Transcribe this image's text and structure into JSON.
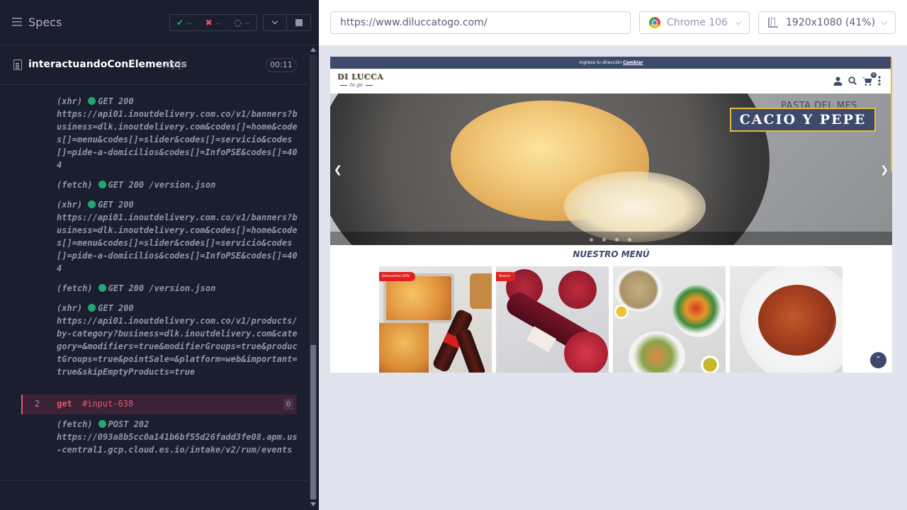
{
  "runner": {
    "header": {
      "title": "Specs",
      "stats": {
        "passed": "--",
        "failed": "--",
        "pending": "--"
      }
    },
    "file": {
      "name": "interactuandoConElementos",
      "ext": ".cy.js",
      "time": "00:11"
    },
    "logs": [
      {
        "type": "(xhr)",
        "status": "GET 200",
        "url": "https://api01.inoutdelivery.com.co/v1/banners?business=dlk.inoutdelivery.com&codes[]=home&codes[]=menu&codes[]=slider&codes[]=servicio&codes[]=pide-a-domicilios&codes[]=InfoPSE&codes[]=404"
      },
      {
        "type": "(fetch)",
        "status": "GET 200 /version.json",
        "url": ""
      },
      {
        "type": "(xhr)",
        "status": "GET 200",
        "url": "https://api01.inoutdelivery.com.co/v1/banners?business=dlk.inoutdelivery.com&codes[]=home&codes[]=menu&codes[]=slider&codes[]=servicio&codes[]=pide-a-domicilios&codes[]=InfoPSE&codes[]=404"
      },
      {
        "type": "(fetch)",
        "status": "GET 200 /version.json",
        "url": ""
      },
      {
        "type": "(xhr)",
        "status": "GET 200",
        "url": "https://api01.inoutdelivery.com.co/v1/products/by-category?business=dlk.inoutdelivery.com&category=&modifiers=true&modifierGroups=true&productGroups=true&pointSale=&platform=web&important=true&skipEmptyProducts=true"
      }
    ],
    "command": {
      "number": "2",
      "name": "get",
      "arg": "#input-638",
      "count": "0"
    },
    "last_log": {
      "type": "(fetch)",
      "status": "POST 202",
      "url": "https://093a8b5cc0a141b6bf55d26fadd3fe08.apm.us-central1.gcp.cloud.es.io/intake/v2/rum/events"
    }
  },
  "browser": {
    "url": "https://www.diluccatogo.com/",
    "browser_name": "Chrome 106",
    "viewport": "1920x1080 (41%)"
  },
  "site": {
    "address_prefix": "Ingresa tu dirección",
    "address_link": "Cambiar",
    "logo_top": "DI LUCCA",
    "logo_bottom": "to go",
    "promo_subtitle": "PASTA DEL MES",
    "promo_title": "CACIO Y PEPE",
    "menu_title": "NUESTRO MENÚ",
    "cart_count": "0",
    "cards": [
      {
        "badge": "Descuento 20%"
      },
      {
        "badge": "Nuevo"
      },
      {
        "badge": ""
      },
      {
        "badge": ""
      }
    ]
  },
  "colors": {
    "brand_navy": "#3d4a6b",
    "brand_gold": "#e8b935",
    "pass": "#1fa971",
    "fail": "#e45770"
  },
  "icons": {
    "header": "specs-list-icon",
    "nav": [
      "user-icon",
      "search-icon",
      "cart-icon",
      "more-vertical-icon"
    ]
  }
}
